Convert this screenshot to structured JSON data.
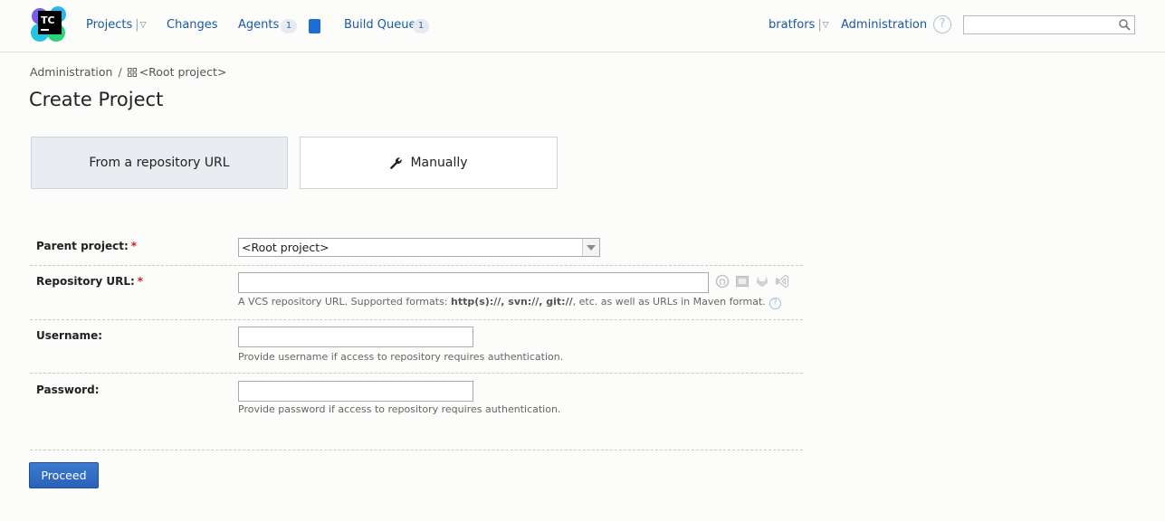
{
  "header": {
    "logo_text": "TC",
    "nav": {
      "projects": "Projects",
      "changes": "Changes",
      "agents": "Agents",
      "agents_count": "1",
      "build_queue": "Build Queue",
      "build_queue_count": "1"
    },
    "user": "bratfors",
    "administration": "Administration",
    "help_symbol": "?",
    "search": {
      "value": "",
      "placeholder": ""
    },
    "icons": [
      "teamcity-logo",
      "chevron-down-icon",
      "help-icon",
      "search-icon"
    ]
  },
  "breadcrumb": {
    "items": [
      "Administration",
      "<Root project>"
    ],
    "separator": "/"
  },
  "page_title": "Create Project",
  "mode_tabs": [
    {
      "label": "From a repository URL",
      "active": true
    },
    {
      "label": "Manually",
      "active": false,
      "icon": "wrench-icon"
    }
  ],
  "form": {
    "parent_project": {
      "label": "Parent project:",
      "required_mark": "*",
      "selected": "<Root project>"
    },
    "repository_url": {
      "label": "Repository URL:",
      "required_mark": "*",
      "value": "",
      "hint_prefix": "A VCS repository URL. Supported formats: ",
      "hint_formats": "http(s)://, svn://, git://",
      "hint_suffix": ", etc. as well as URLs in Maven format.",
      "icons": [
        "github-icon",
        "bitbucket-icon",
        "gitlab-icon",
        "visual-studio-icon"
      ]
    },
    "username": {
      "label": "Username:",
      "value": "",
      "hint": "Provide username if access to repository requires authentication."
    },
    "password": {
      "label": "Password:",
      "value": "",
      "hint": "Provide password if access to repository requires authentication."
    }
  },
  "proceed_label": "Proceed",
  "colors": {
    "link": "#1a5aa0",
    "accent_button": "#2f6cc4",
    "required": "#d02020",
    "active_tab_bg": "#e9edf2"
  }
}
